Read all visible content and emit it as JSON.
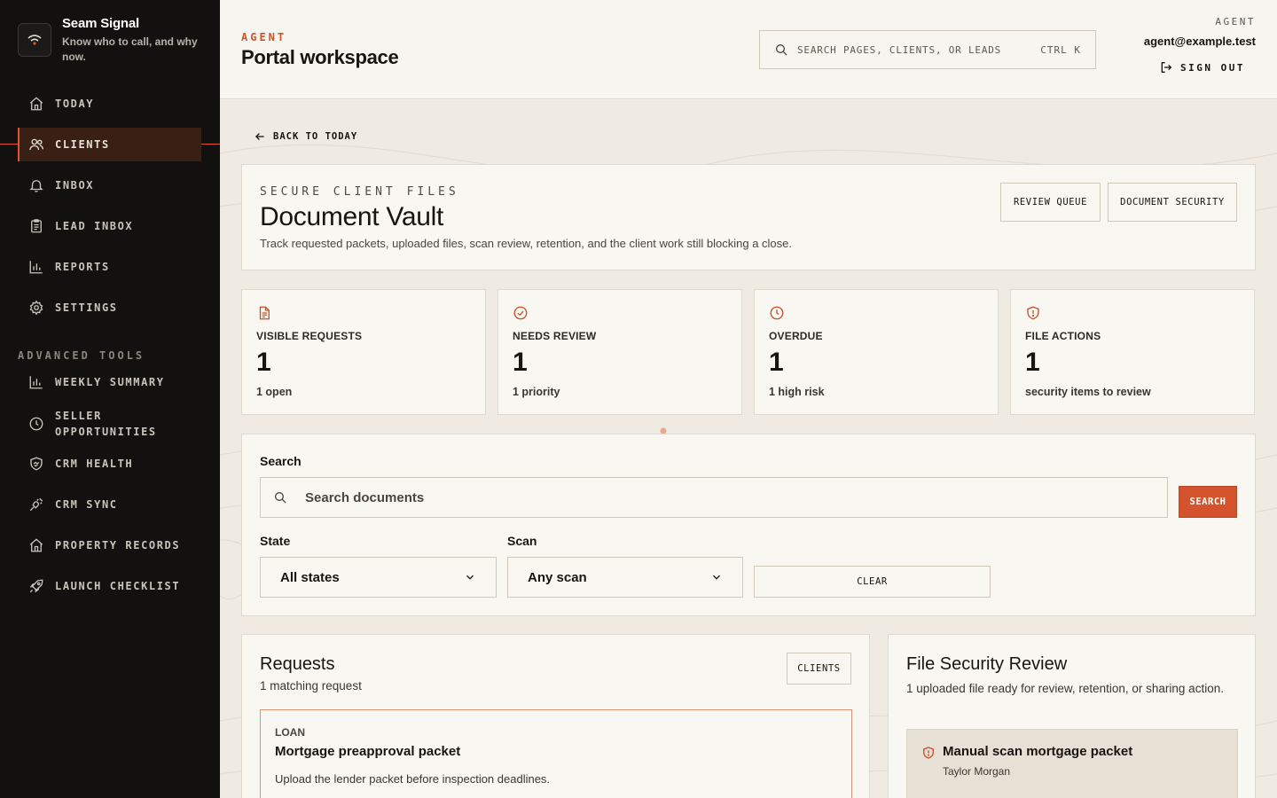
{
  "brand": {
    "name": "Seam Signal",
    "tagline": "Know who to call, and why now."
  },
  "nav": {
    "items": [
      {
        "label": "TODAY",
        "icon": "home-icon"
      },
      {
        "label": "CLIENTS",
        "icon": "users-icon",
        "active": true
      },
      {
        "label": "INBOX",
        "icon": "bell-icon"
      },
      {
        "label": "LEAD INBOX",
        "icon": "clipboard-icon"
      },
      {
        "label": "REPORTS",
        "icon": "bar-chart-icon"
      },
      {
        "label": "SETTINGS",
        "icon": "gear-icon"
      }
    ],
    "advanced_label": "ADVANCED TOOLS",
    "advanced": [
      {
        "label": "WEEKLY SUMMARY",
        "icon": "bar-chart-icon"
      },
      {
        "label": "SELLER OPPORTUNITIES",
        "icon": "clock-icon"
      },
      {
        "label": "CRM HEALTH",
        "icon": "handshake-icon"
      },
      {
        "label": "CRM SYNC",
        "icon": "plug-icon"
      },
      {
        "label": "PROPERTY RECORDS",
        "icon": "home-icon"
      },
      {
        "label": "LAUNCH CHECKLIST",
        "icon": "rocket-icon"
      }
    ]
  },
  "header": {
    "eyebrow": "AGENT",
    "title": "Portal workspace",
    "search_placeholder": "SEARCH PAGES, CLIENTS, OR LEADS",
    "shortcut": "CTRL K",
    "role": "AGENT",
    "email": "agent@example.test",
    "sign_out": "SIGN OUT"
  },
  "back_link": "BACK TO TODAY",
  "vault": {
    "eyebrow": "SECURE CLIENT FILES",
    "title": "Document Vault",
    "description": "Track requested packets, uploaded files, scan review, retention, and the client work still blocking a close.",
    "review_queue": "REVIEW QUEUE",
    "document_security": "DOCUMENT SECURITY"
  },
  "stats": [
    {
      "label": "VISIBLE REQUESTS",
      "value": "1",
      "sub": "1 open",
      "icon": "document-icon"
    },
    {
      "label": "NEEDS REVIEW",
      "value": "1",
      "sub": "1 priority",
      "icon": "check-circle-icon"
    },
    {
      "label": "OVERDUE",
      "value": "1",
      "sub": "1 high risk",
      "icon": "clock-icon"
    },
    {
      "label": "FILE ACTIONS",
      "value": "1",
      "sub": "security items to review",
      "icon": "shield-icon"
    }
  ],
  "filters": {
    "search_label": "Search",
    "search_placeholder": "Search documents",
    "search_button": "SEARCH",
    "state_label": "State",
    "state_value": "All states",
    "scan_label": "Scan",
    "scan_value": "Any scan",
    "clear_button": "CLEAR"
  },
  "requests": {
    "title": "Requests",
    "subtitle": "1 matching request",
    "clients_button": "CLIENTS",
    "items": [
      {
        "type": "LOAN",
        "title": "Mortgage preapproval packet",
        "description": "Upload the lender packet before inspection deadlines."
      }
    ]
  },
  "security": {
    "title": "File Security Review",
    "subtitle": "1 uploaded file ready for review, retention, or sharing action.",
    "items": [
      {
        "title": "Manual scan mortgage packet",
        "client": "Taylor Morgan"
      }
    ]
  },
  "colors": {
    "accent": "#d5532c",
    "sidebar_bg": "#121110",
    "page_bg": "#efebe3"
  }
}
